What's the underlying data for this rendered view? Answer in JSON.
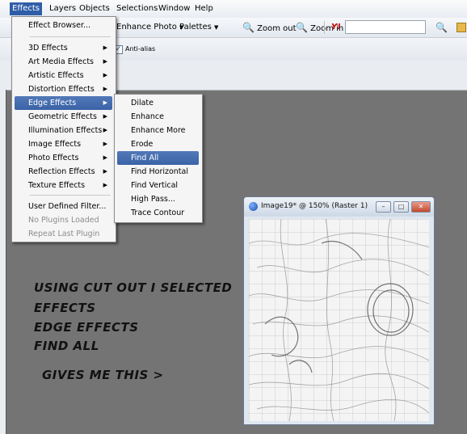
{
  "menubar": {
    "items": [
      "Effects",
      "Layers",
      "Objects",
      "Selections",
      "Window",
      "Help"
    ]
  },
  "toolbar": {
    "enhance_photo": "Enhance Photo",
    "palettes": "Palettes",
    "zoom_out": "Zoom out",
    "zoom_in": "Zoom in",
    "search_value": ""
  },
  "options": {
    "anti_alias": "Anti-alias",
    "anti_alias_checked": true
  },
  "effects_menu": {
    "items": [
      {
        "label": "Effect Browser...",
        "submenu": false,
        "disabled": false
      },
      {
        "label": "3D Effects",
        "submenu": true,
        "disabled": false
      },
      {
        "label": "Art Media Effects",
        "submenu": true,
        "disabled": false
      },
      {
        "label": "Artistic Effects",
        "submenu": true,
        "disabled": false
      },
      {
        "label": "Distortion Effects",
        "submenu": true,
        "disabled": false
      },
      {
        "label": "Edge Effects",
        "submenu": true,
        "disabled": false,
        "highlighted": true
      },
      {
        "label": "Geometric Effects",
        "submenu": true,
        "disabled": false
      },
      {
        "label": "Illumination Effects",
        "submenu": true,
        "disabled": false
      },
      {
        "label": "Image Effects",
        "submenu": true,
        "disabled": false
      },
      {
        "label": "Photo Effects",
        "submenu": true,
        "disabled": false
      },
      {
        "label": "Reflection Effects",
        "submenu": true,
        "disabled": false
      },
      {
        "label": "Texture Effects",
        "submenu": true,
        "disabled": false
      },
      {
        "label": "User Defined Filter...",
        "submenu": false,
        "disabled": false
      },
      {
        "label": "No Plugins Loaded",
        "submenu": false,
        "disabled": true
      },
      {
        "label": "Repeat Last Plugin",
        "submenu": false,
        "disabled": true
      }
    ]
  },
  "edge_submenu": {
    "items": [
      {
        "label": "Dilate"
      },
      {
        "label": "Enhance"
      },
      {
        "label": "Enhance More"
      },
      {
        "label": "Erode"
      },
      {
        "label": "Find All",
        "highlighted": true
      },
      {
        "label": "Find Horizontal"
      },
      {
        "label": "Find Vertical"
      },
      {
        "label": "High Pass..."
      },
      {
        "label": "Trace Contour"
      }
    ]
  },
  "annotation": {
    "lines": [
      "USING CUT OUT I SELECTED",
      "EFFECTS",
      "EDGE EFFECTS",
      "FIND ALL",
      "GIVES ME THIS >"
    ]
  },
  "image_window": {
    "title": "Image19* @ 150% (Raster 1)"
  },
  "colors": {
    "workspace": "#747474",
    "menu_highlight": "#3a63a6"
  }
}
